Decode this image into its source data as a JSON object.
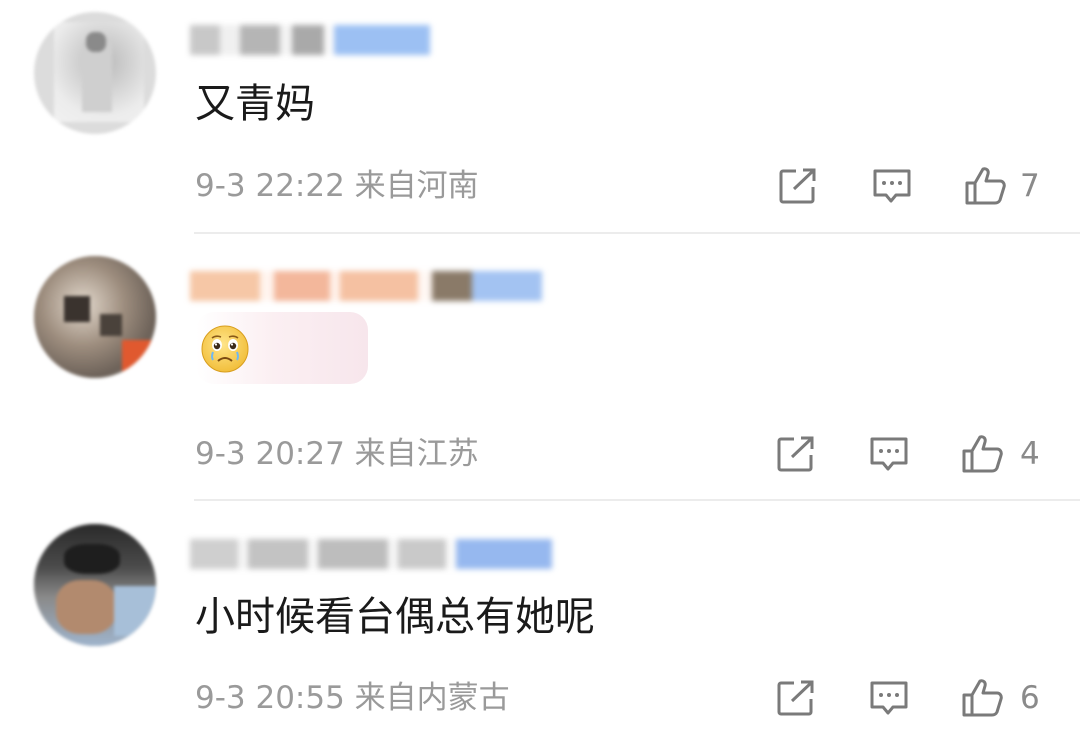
{
  "comments": [
    {
      "content": "又青妈",
      "time": "9-3 22:22 来自河南",
      "likes": "7",
      "emoji": "",
      "avatar_icon": "user-avatar-icon"
    },
    {
      "content": "",
      "time": "9-3 20:27 来自江苏",
      "likes": "4",
      "emoji": "crying-face-emoji",
      "avatar_icon": "user-avatar-icon"
    },
    {
      "content": "小时候看台偶总有她呢",
      "time": "9-3 20:55 来自内蒙古",
      "likes": "6",
      "emoji": "",
      "avatar_icon": "user-avatar-icon"
    }
  ],
  "icons": {
    "repost": "repost-icon",
    "reply": "comment-icon",
    "like": "thumbs-up-icon"
  },
  "colors": {
    "meta_text": "#9a9a9a",
    "icon_stroke": "#7a7a7a",
    "divider": "#ececec",
    "badge_blue": "#8fb4f0"
  }
}
